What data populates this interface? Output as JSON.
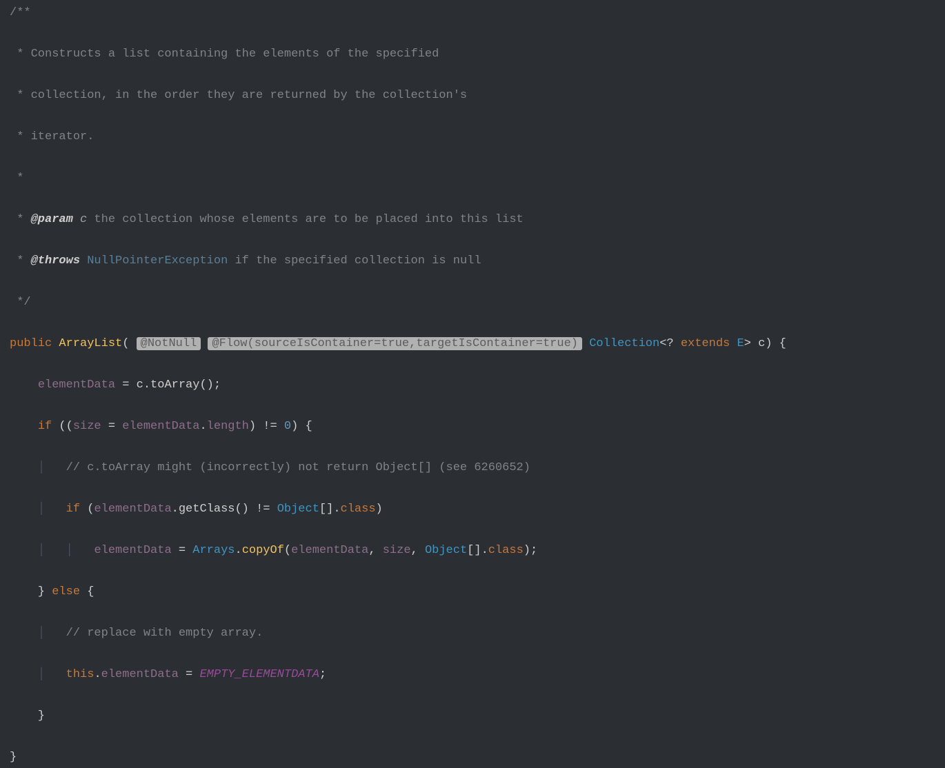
{
  "code": {
    "doc_open": "/**",
    "doc_line1": " * Constructs a list containing the elements of the specified",
    "doc_line2": " * collection, in the order they are returned by the collection's",
    "doc_line3": " * iterator.",
    "doc_blank": " *",
    "doc_param_tag": "@param",
    "doc_param_name": "c",
    "doc_param_desc": "the collection whose elements are to be placed into this list",
    "doc_throws_tag": "@throws",
    "doc_throws_type": "NullPointerException",
    "doc_throws_desc": "if the specified collection is null",
    "doc_close": " */",
    "kw_public": "public",
    "ctor_name": "ArrayList",
    "anno_notnull": "@NotNull",
    "anno_flow": "@Flow(sourceIsContainer=true,targetIsContainer=true)",
    "type_collection": "Collection",
    "generic_open": "<?",
    "kw_extends": "extends",
    "type_E": "E",
    "param_c": "c",
    "assign1_lhs": "elementData",
    "assign1_rhs_obj": "c",
    "assign1_rhs_call": "toArray",
    "kw_if": "if",
    "cond_var_size": "size",
    "cond_var_ed": "elementData",
    "cond_prop_len": "length",
    "cond_neq": "!=",
    "cond_zero": "0",
    "comment_inner1": "// c.toArray might (incorrectly) not return Object[] (see 6260652)",
    "inner_if_lhs": "elementData",
    "inner_if_getclass": "getClass",
    "type_object": "Object",
    "type_arr_suffix": "[].",
    "kw_class": "class",
    "copy_lhs": "elementData",
    "type_arrays": "Arrays",
    "call_copyof": "copyOf",
    "arg_ed": "elementData",
    "arg_size": "size",
    "kw_else": "else",
    "comment_inner2": "// replace with empty array.",
    "kw_this": "this",
    "this_prop": "elementData",
    "const_empty": "EMPTY_ELEMENTDATA"
  }
}
